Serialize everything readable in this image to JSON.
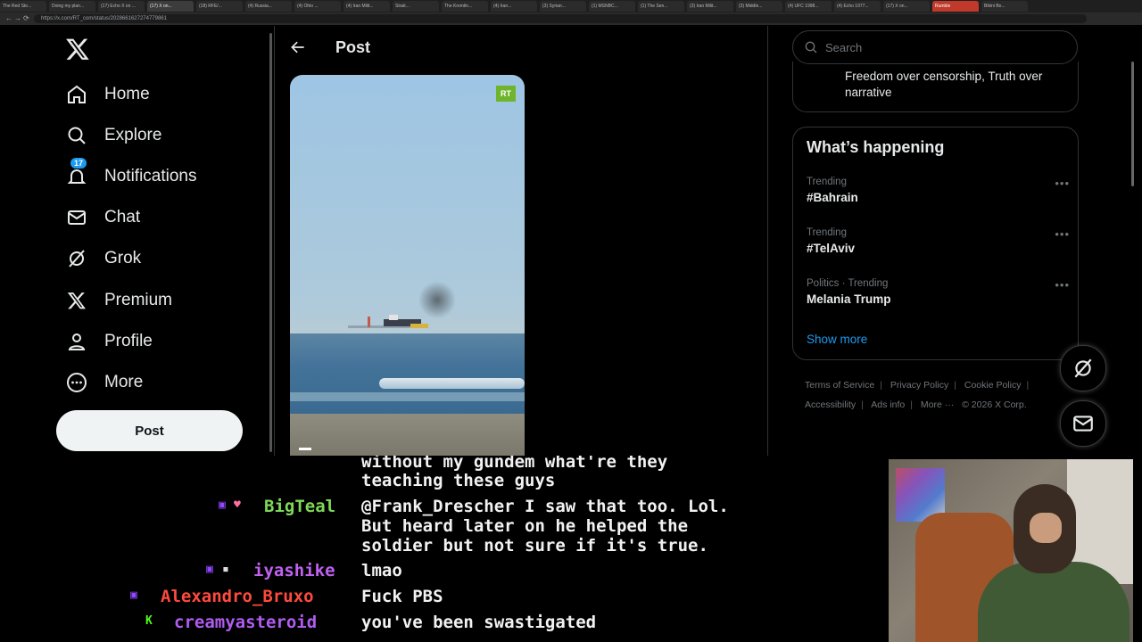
{
  "browser": {
    "tabs": [
      "The Red Sto...",
      "Doing my plan...",
      "(17) Echo X on ...",
      "(17) X on...",
      "(18) RFE/...",
      "(4) Russia...",
      "(4) Ohio ...",
      "(4) Iran Milit...",
      "Strait...",
      "The Kremlin...",
      "(4) Iran...",
      "(3) Syrian...",
      "(1) MSNBC...",
      "(1) The Sen...",
      "(3) Iran Milit...",
      "(3) Middle...",
      "(4) UFC 1998...",
      "(4) Echo 1977...",
      "(17) X on...",
      "Rumble",
      "Bikini Bo..."
    ],
    "active_tab_index": 3,
    "red_tab_index": 19,
    "url": "https://x.com/RT_com/status/2028661627274779861"
  },
  "sidebar": {
    "logo": "x-logo-icon",
    "items": [
      {
        "label": "Home",
        "icon": "home-icon"
      },
      {
        "label": "Explore",
        "icon": "search-icon"
      },
      {
        "label": "Notifications",
        "icon": "bell-icon",
        "badge": "17"
      },
      {
        "label": "Chat",
        "icon": "mail-icon"
      },
      {
        "label": "Grok",
        "icon": "grok-icon"
      },
      {
        "label": "Premium",
        "icon": "x-premium-icon"
      },
      {
        "label": "Profile",
        "icon": "person-icon"
      },
      {
        "label": "More",
        "icon": "more-circle-icon"
      }
    ],
    "post_button": "Post"
  },
  "main": {
    "title": "Post",
    "video_badge": "RT"
  },
  "right": {
    "search_placeholder": "Search",
    "bio_text": "Freedom over censorship, Truth over narrative",
    "happening": {
      "title": "What’s happening",
      "trends": [
        {
          "meta": "Trending",
          "name": "#Bahrain"
        },
        {
          "meta": "Trending",
          "name": "#TelAviv"
        },
        {
          "meta": "Politics · Trending",
          "name": "Melania Trump"
        }
      ],
      "show_more": "Show more"
    },
    "footer": {
      "links": [
        "Terms of Service",
        "Privacy Policy",
        "Cookie Policy",
        "Accessibility",
        "Ads info",
        "More ···"
      ],
      "copyright": "© 2026 X Corp."
    }
  },
  "chat": {
    "lines": [
      {
        "user": "",
        "text": "without my gundem what're they",
        "user_color": "#ffffff"
      },
      {
        "user": "",
        "text": "teaching these guys",
        "user_color": "#ffffff"
      },
      {
        "user": "BigTeal",
        "text": "@Frank_Drescher I saw that too. Lol.",
        "user_color": "#7ed957"
      },
      {
        "user": "",
        "text": "But heard later on he helped the",
        "user_color": "#ffffff"
      },
      {
        "user": "",
        "text": "soldier but not sure if it's true.",
        "user_color": "#ffffff"
      },
      {
        "user": "iyashike",
        "text": "lmao",
        "user_color": "#c061f0"
      },
      {
        "user": "Alexandro_Bruxo",
        "text": "Fuck PBS",
        "user_color": "#ff4a3d"
      },
      {
        "user": "creamyasteroid",
        "text": "you've been swastigated",
        "user_color": "#b15cf0"
      }
    ]
  },
  "colors": {
    "accent": "#1d9bf0",
    "rt_green": "#6fb52c",
    "twitch_purple": "#9146ff"
  }
}
